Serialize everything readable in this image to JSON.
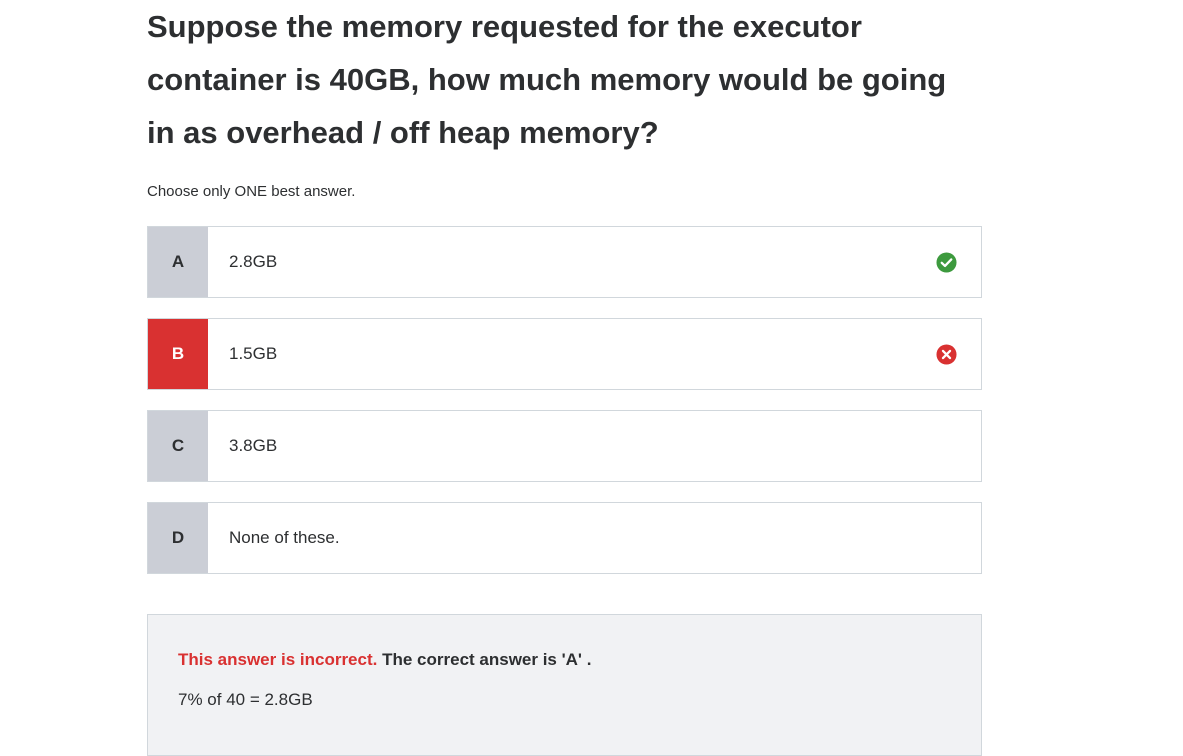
{
  "question": "Suppose the memory requested for the executor container is 40GB, how much memory would be going in as overhead / off heap memory?",
  "instruction": "Choose only ONE best answer.",
  "options": [
    {
      "letter": "A",
      "text": "2.8GB",
      "status": "correct"
    },
    {
      "letter": "B",
      "text": "1.5GB",
      "status": "incorrect-selected"
    },
    {
      "letter": "C",
      "text": "3.8GB",
      "status": "none"
    },
    {
      "letter": "D",
      "text": "None of these.",
      "status": "none"
    }
  ],
  "feedback": {
    "incorrect_label": "This answer is incorrect.",
    "correct_answer_text": "The correct answer is 'A' .",
    "explanation": "7% of 40 = 2.8GB"
  },
  "colors": {
    "correct": "#3d9a3e",
    "incorrect": "#d93131",
    "letter_bg": "#cbced6"
  },
  "icons": {
    "correct": "check-circle-icon",
    "incorrect": "x-circle-icon"
  }
}
